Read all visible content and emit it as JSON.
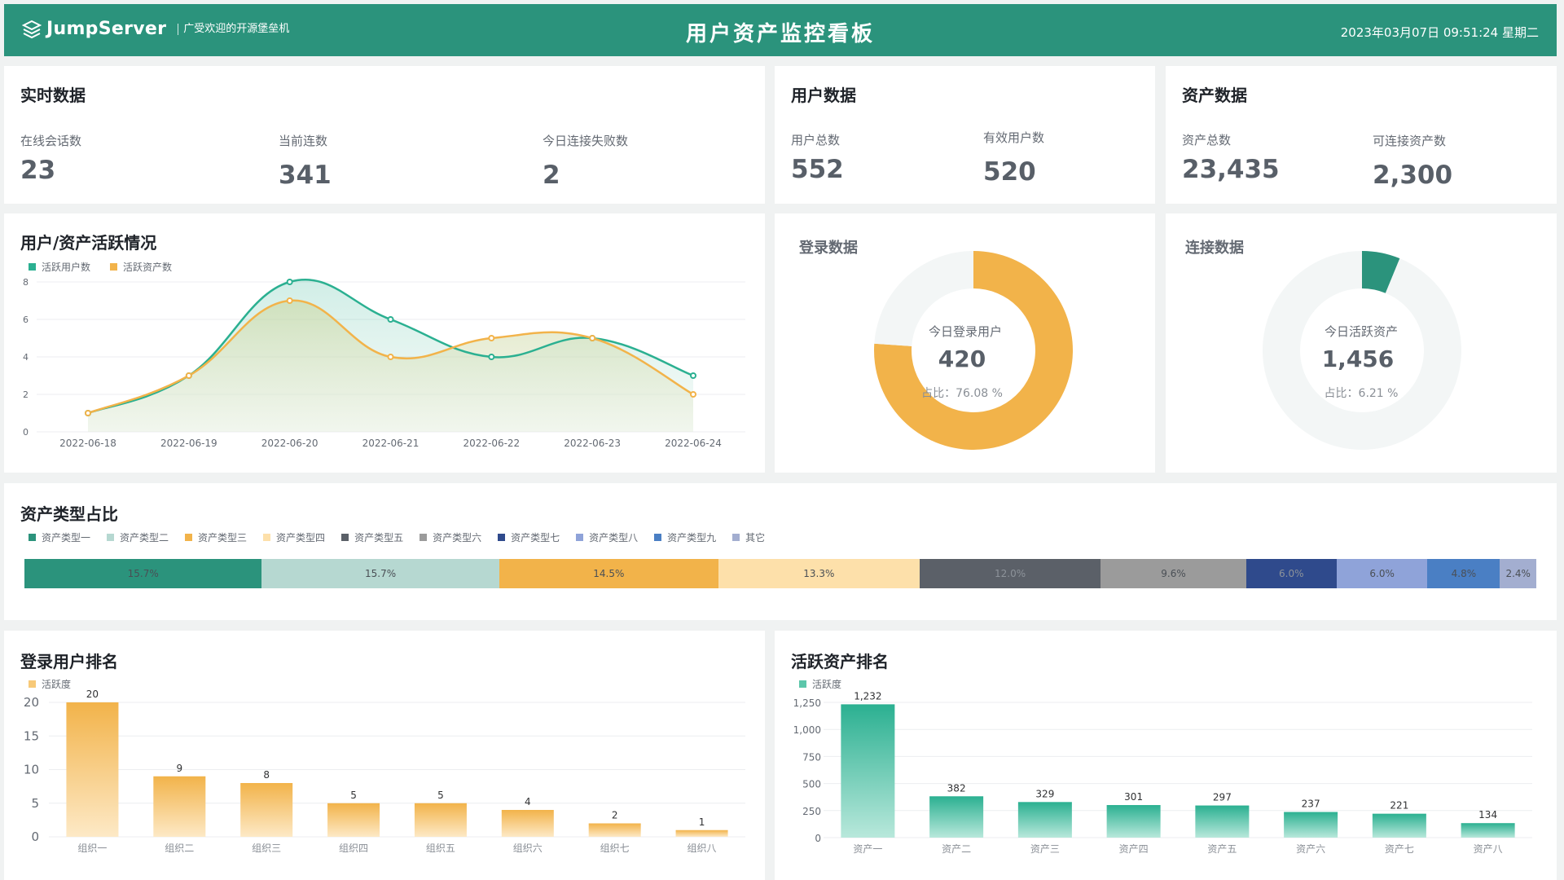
{
  "header": {
    "logo_text": "JumpServer",
    "logo_subtitle": "广受欢迎的开源堡垒机",
    "title": "用户资产监控看板",
    "datetime": "2023年03月07日 09:51:24 星期二"
  },
  "realtime": {
    "title": "实时数据",
    "stats": [
      {
        "label": "在线会话数",
        "value": "23"
      },
      {
        "label": "当前连数",
        "value": "341"
      },
      {
        "label": "今日连接失败数",
        "value": "2"
      }
    ]
  },
  "users": {
    "title": "用户数据",
    "stats": [
      {
        "label": "用户总数",
        "value": "552"
      },
      {
        "label": "有效用户数",
        "value": "520"
      }
    ]
  },
  "assets": {
    "title": "资产数据",
    "stats": [
      {
        "label": "资产总数",
        "value": "23,435"
      },
      {
        "label": "可连接资产数",
        "value": "2,300"
      }
    ]
  },
  "activity": {
    "title": "用户/资产活跃情况",
    "chart_data": {
      "type": "line",
      "x": [
        "2022-06-18",
        "2022-06-19",
        "2022-06-20",
        "2022-06-21",
        "2022-06-22",
        "2022-06-23",
        "2022-06-24"
      ],
      "series": [
        {
          "name": "活跃用户数",
          "color": "#2bb091",
          "values": [
            1,
            3,
            8,
            6,
            4,
            5,
            3
          ]
        },
        {
          "name": "活跃资产数",
          "color": "#f2b34a",
          "values": [
            1,
            3,
            7,
            4,
            5,
            5,
            2
          ]
        }
      ],
      "yticks": [
        "0",
        "2",
        "4",
        "6",
        "8"
      ],
      "ylim": [
        0,
        8
      ],
      "grid": true,
      "legend": "top-left"
    }
  },
  "login": {
    "title": "登录数据",
    "center_label": "今日登录用户",
    "center_value": "420",
    "ratio_text": "占比：76.08 %",
    "chart_data": {
      "type": "pie",
      "values": [
        76.08,
        23.92
      ],
      "colors": [
        "#f2b34a",
        "#f3f6f6"
      ]
    }
  },
  "connect": {
    "title": "连接数据",
    "center_label": "今日活跃资产",
    "center_value": "1,456",
    "ratio_text": "占比：6.21 %",
    "chart_data": {
      "type": "pie",
      "values": [
        6.21,
        93.79
      ],
      "colors": [
        "#2b937c",
        "#f3f6f6"
      ]
    }
  },
  "asset_types": {
    "title": "资产类型占比",
    "chart_data": {
      "type": "bar",
      "categories": [
        "资产类型一",
        "资产类型二",
        "资产类型三",
        "资产类型四",
        "资产类型五",
        "资产类型六",
        "资产类型七",
        "资产类型八",
        "资产类型九",
        "其它"
      ],
      "values": [
        15.7,
        15.7,
        14.5,
        13.3,
        12.0,
        9.6,
        6.0,
        6.0,
        4.8,
        2.4
      ],
      "labels": [
        "15.7%",
        "15.7%",
        "14.5%",
        "13.3%",
        "12.0%",
        "9.6%",
        "6.0%",
        "6.0%",
        "4.8%",
        "2.4%"
      ],
      "colors": [
        "#2b937c",
        "#b6d8d1",
        "#f2b34a",
        "#fde0aa",
        "#5b6068",
        "#9b9b9b",
        "#2f4a8c",
        "#8fa3d9",
        "#4a7fc4",
        "#a3aed0"
      ]
    }
  },
  "user_rank": {
    "title": "登录用户排名",
    "chart_data": {
      "type": "bar",
      "categories": [
        "组织一",
        "组织二",
        "组织三",
        "组织四",
        "组织五",
        "组织六",
        "组织七",
        "组织八"
      ],
      "series": [
        {
          "name": "活跃度",
          "values": [
            20,
            9,
            8,
            5,
            5,
            4,
            2,
            1
          ]
        }
      ],
      "yticks": [
        "0",
        "5",
        "10",
        "15",
        "20"
      ],
      "ylim": [
        0,
        20
      ],
      "color_top": "#f2b34a",
      "color_bottom": "#fde9c6"
    }
  },
  "asset_rank": {
    "title": "活跃资产排名",
    "chart_data": {
      "type": "bar",
      "categories": [
        "资产一",
        "资产二",
        "资产三",
        "资产四",
        "资产五",
        "资产六",
        "资产七",
        "资产八"
      ],
      "series": [
        {
          "name": "活跃度",
          "values": [
            1232,
            382,
            329,
            301,
            297,
            237,
            221,
            134
          ]
        }
      ],
      "value_labels": [
        "1,232",
        "382",
        "329",
        "301",
        "297",
        "237",
        "221",
        "134"
      ],
      "yticks": [
        "0",
        "250",
        "500",
        "750",
        "1,000",
        "1,250"
      ],
      "ylim": [
        0,
        1250
      ],
      "color_top": "#2bb091",
      "color_bottom": "#b8e8db"
    }
  }
}
